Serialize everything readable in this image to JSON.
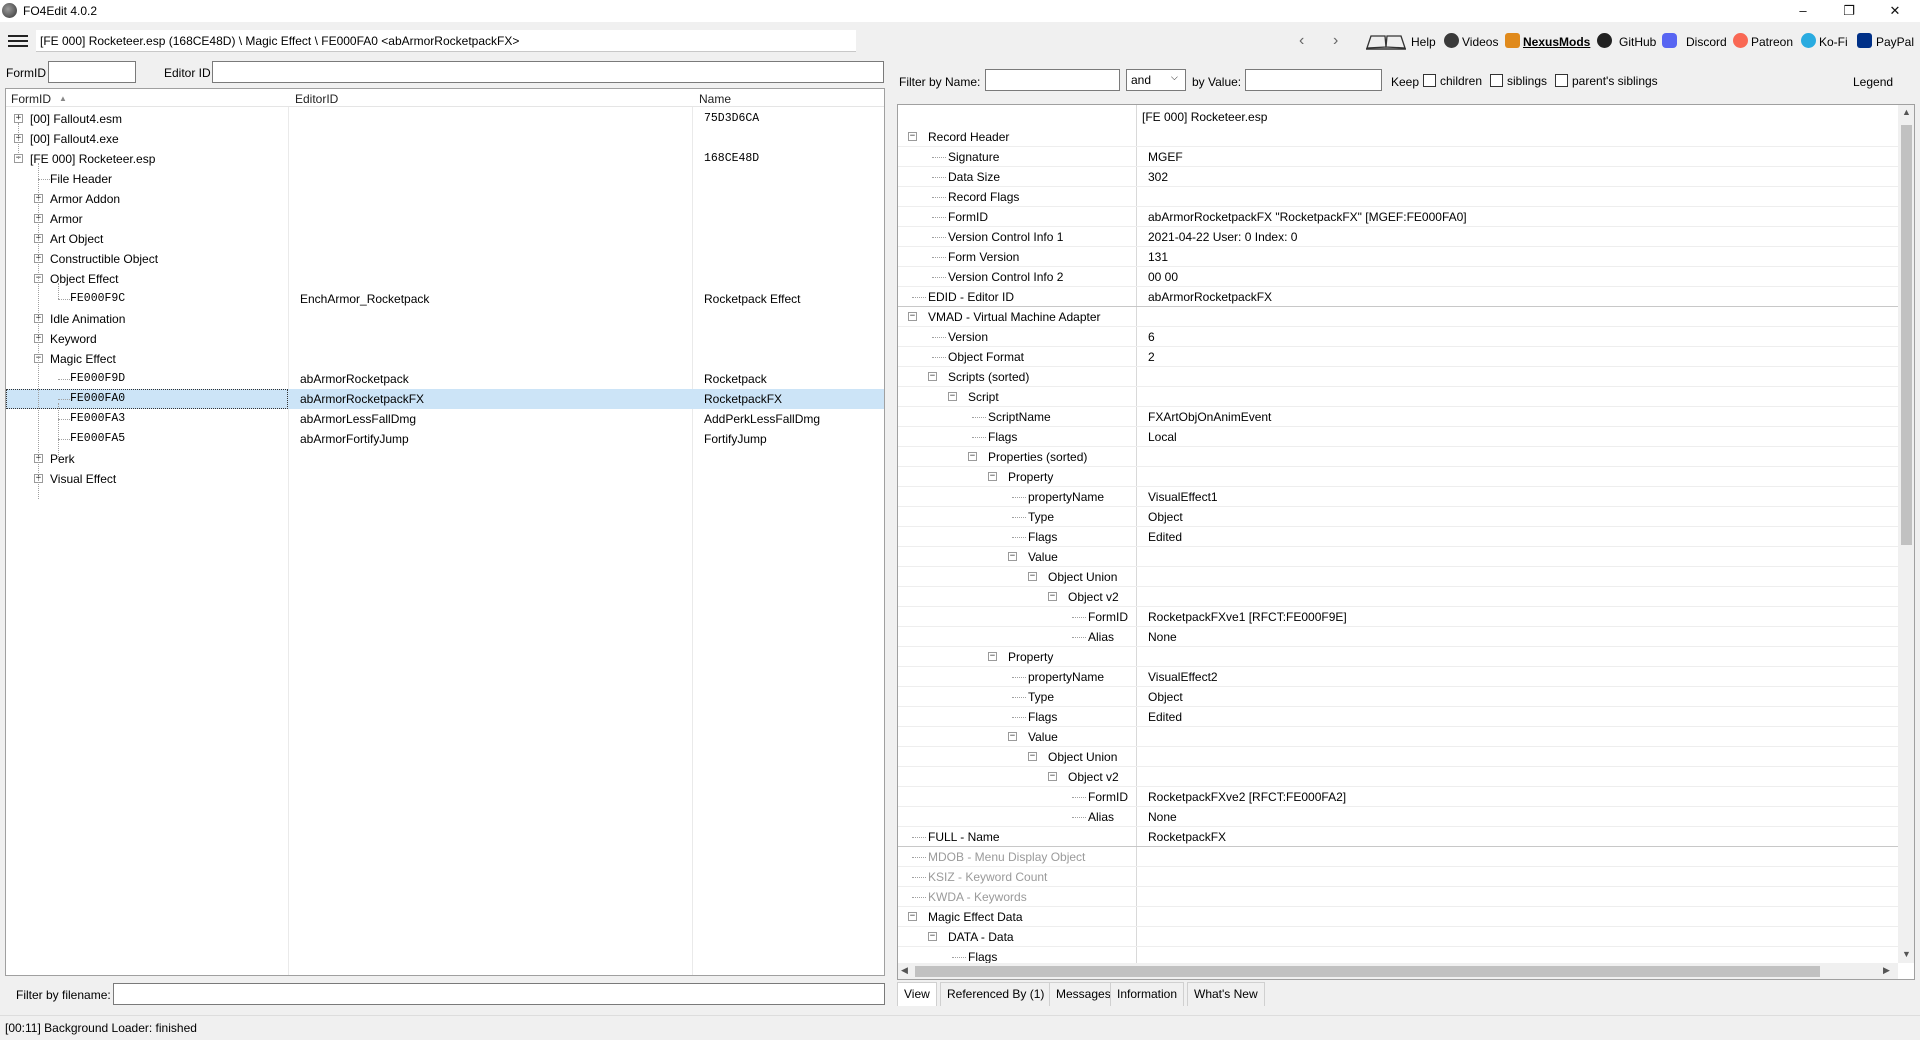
{
  "window": {
    "title": "FO4Edit 4.0.2",
    "minimize": "–",
    "maximize": "❐",
    "close": "✕"
  },
  "toolbar": {
    "nav_path": "[FE 000] Rocketeer.esp (168CE48D) \\ Magic Effect \\ FE000FA0 <abArmorRocketpackFX>",
    "back": "‹",
    "forward": "›",
    "links": {
      "help": "Help",
      "videos": "Videos",
      "nexusmods": "NexusMods",
      "github": "GitHub",
      "discord": "Discord",
      "patreon": "Patreon",
      "kofi": "Ko-Fi",
      "paypal": "PayPal"
    }
  },
  "left_filter": {
    "formid_label": "FormID",
    "formid_value": "",
    "editorid_label": "Editor ID",
    "editorid_value": ""
  },
  "tree": {
    "headers": {
      "formid": "FormID",
      "editorid": "EditorID",
      "name": "Name"
    },
    "sort_arrow": "▲",
    "rows": [
      {
        "label": "[00] Fallout4.esm",
        "editor": "",
        "name": "75D3D6CA"
      },
      {
        "label": "[00] Fallout4.exe",
        "editor": "",
        "name": ""
      },
      {
        "label": "[FE 000] Rocketeer.esp",
        "editor": "",
        "name": "168CE48D"
      },
      {
        "label": "File Header",
        "editor": "",
        "name": ""
      },
      {
        "label": "Armor Addon",
        "editor": "",
        "name": ""
      },
      {
        "label": "Armor",
        "editor": "",
        "name": ""
      },
      {
        "label": "Art Object",
        "editor": "",
        "name": ""
      },
      {
        "label": "Constructible Object",
        "editor": "",
        "name": ""
      },
      {
        "label": "Object Effect",
        "editor": "",
        "name": ""
      },
      {
        "label": "FE000F9C",
        "editor": "EnchArmor_Rocketpack",
        "name": "Rocketpack Effect"
      },
      {
        "label": "Idle Animation",
        "editor": "",
        "name": ""
      },
      {
        "label": "Keyword",
        "editor": "",
        "name": ""
      },
      {
        "label": "Magic Effect",
        "editor": "",
        "name": ""
      },
      {
        "label": "FE000F9D",
        "editor": "abArmorRocketpack",
        "name": "Rocketpack"
      },
      {
        "label": "FE000FA0",
        "editor": "abArmorRocketpackFX",
        "name": "RocketpackFX"
      },
      {
        "label": "FE000FA3",
        "editor": "abArmorLessFallDmg",
        "name": "AddPerkLessFallDmg"
      },
      {
        "label": "FE000FA5",
        "editor": "abArmorFortifyJump",
        "name": "FortifyJump"
      },
      {
        "label": "Perk",
        "editor": "",
        "name": ""
      },
      {
        "label": "Visual Effect",
        "editor": "",
        "name": ""
      }
    ]
  },
  "filename_filter": {
    "label": "Filter by filename:",
    "value": ""
  },
  "status": {
    "text": "[00:11] Background Loader: finished"
  },
  "right_filter": {
    "by_name_label": "Filter by Name:",
    "by_name_value": "",
    "operator": "and",
    "by_value_label": "by Value:",
    "by_value_value": "",
    "keep_label": "Keep",
    "children_label": "children",
    "siblings_label": "siblings",
    "parents_siblings_label": "parent's siblings",
    "legend": "Legend"
  },
  "record_view": {
    "file_header": "[FE 000] Rocketeer.esp",
    "rows": [
      {
        "key": "Record Header",
        "value": ""
      },
      {
        "key": "Signature",
        "value": "MGEF"
      },
      {
        "key": "Data Size",
        "value": "302"
      },
      {
        "key": "Record Flags",
        "value": ""
      },
      {
        "key": "FormID",
        "value": "abArmorRocketpackFX \"RocketpackFX\" [MGEF:FE000FA0]"
      },
      {
        "key": "Version Control Info 1",
        "value": "2021-04-22 User: 0 Index: 0"
      },
      {
        "key": "Form Version",
        "value": "131"
      },
      {
        "key": "Version Control Info 2",
        "value": "00 00"
      },
      {
        "key": "EDID - Editor ID",
        "value": "abArmorRocketpackFX"
      },
      {
        "key": "VMAD - Virtual Machine Adapter",
        "value": ""
      },
      {
        "key": "Version",
        "value": "6"
      },
      {
        "key": "Object Format",
        "value": "2"
      },
      {
        "key": "Scripts (sorted)",
        "value": ""
      },
      {
        "key": "Script",
        "value": ""
      },
      {
        "key": "ScriptName",
        "value": "FXArtObjOnAnimEvent"
      },
      {
        "key": "Flags",
        "value": "Local"
      },
      {
        "key": "Properties (sorted)",
        "value": ""
      },
      {
        "key": "Property",
        "value": ""
      },
      {
        "key": "propertyName",
        "value": "VisualEffect1"
      },
      {
        "key": "Type",
        "value": "Object"
      },
      {
        "key": "Flags",
        "value": "Edited"
      },
      {
        "key": "Value",
        "value": ""
      },
      {
        "key": "Object Union",
        "value": ""
      },
      {
        "key": "Object v2",
        "value": ""
      },
      {
        "key": "FormID",
        "value": "RocketpackFXve1 [RFCT:FE000F9E]"
      },
      {
        "key": "Alias",
        "value": "None"
      },
      {
        "key": "Property",
        "value": ""
      },
      {
        "key": "propertyName",
        "value": "VisualEffect2"
      },
      {
        "key": "Type",
        "value": "Object"
      },
      {
        "key": "Flags",
        "value": "Edited"
      },
      {
        "key": "Value",
        "value": ""
      },
      {
        "key": "Object Union",
        "value": ""
      },
      {
        "key": "Object v2",
        "value": ""
      },
      {
        "key": "FormID",
        "value": "RocketpackFXve2 [RFCT:FE000FA2]"
      },
      {
        "key": "Alias",
        "value": "None"
      },
      {
        "key": "FULL - Name",
        "value": "RocketpackFX"
      },
      {
        "key": "MDOB - Menu Display Object",
        "value": ""
      },
      {
        "key": "KSIZ - Keyword Count",
        "value": ""
      },
      {
        "key": "KWDA - Keywords",
        "value": ""
      },
      {
        "key": "Magic Effect Data",
        "value": ""
      },
      {
        "key": "DATA - Data",
        "value": ""
      },
      {
        "key": "Flags",
        "value": ""
      }
    ],
    "scroll_up": "▲",
    "scroll_down": "▼",
    "scroll_left": "◀",
    "scroll_right": "▶"
  },
  "tabs": [
    "View",
    "Referenced By (1)",
    "Messages",
    "Information",
    "What's New"
  ],
  "colors": {
    "selection": "#cce4f7",
    "grey_text": "#9a9a9a"
  }
}
